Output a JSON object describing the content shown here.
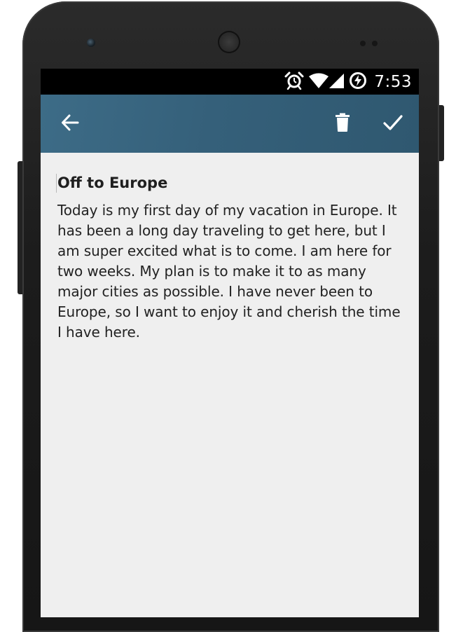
{
  "status_bar": {
    "time": "7:53",
    "icons": [
      "alarm-icon",
      "wifi-icon",
      "signal-icon",
      "battery-charging-icon"
    ]
  },
  "app_bar": {
    "icons": [
      "back-arrow-icon",
      "trash-icon",
      "checkmark-icon"
    ],
    "color": "#35607a"
  },
  "note": {
    "title": "Off to Europe",
    "body": "Today is my first day of my vacation in Europe. It has been a long day traveling to get here, but I am super excited what is to come. I am here for two weeks. My plan is to make it to as many major cities as possible. I have never been to Europe, so I want to enjoy it and cherish the time I have here."
  }
}
